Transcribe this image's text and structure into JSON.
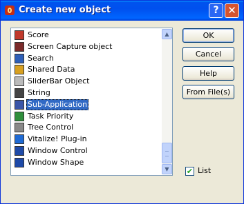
{
  "window": {
    "title": "Create new object",
    "help_glyph": "?",
    "close_glyph": "✕"
  },
  "list": {
    "items": [
      {
        "label": "Score",
        "icon": "score-icon",
        "color": "#c0392b"
      },
      {
        "label": "Screen Capture object",
        "icon": "camera-icon",
        "color": "#7a2a2a"
      },
      {
        "label": "Search",
        "icon": "search-icon",
        "color": "#2e5fb8"
      },
      {
        "label": "Shared Data",
        "icon": "shared-data-icon",
        "color": "#d8a020"
      },
      {
        "label": "SliderBar Object",
        "icon": "slider-icon",
        "color": "#bbbbbb"
      },
      {
        "label": "String",
        "icon": "string-icon",
        "color": "#444444"
      },
      {
        "label": "Sub-Application",
        "icon": "sub-application-icon",
        "color": "#3a56a8",
        "selected": true
      },
      {
        "label": "Task Priority",
        "icon": "task-priority-icon",
        "color": "#2f8f3c"
      },
      {
        "label": "Tree Control",
        "icon": "tree-control-icon",
        "color": "#888888"
      },
      {
        "label": "Vitalize! Plug-in",
        "icon": "plugin-icon",
        "color": "#1e6ad4"
      },
      {
        "label": "Window Control",
        "icon": "window-control-icon",
        "color": "#1e4aa8"
      },
      {
        "label": "Window Shape",
        "icon": "window-shape-icon",
        "color": "#1e4aa8"
      }
    ]
  },
  "buttons": {
    "ok": "OK",
    "cancel": "Cancel",
    "help": "Help",
    "from_files": "From File(s)"
  },
  "checkbox": {
    "label": "List",
    "checked": true,
    "mark": "✔"
  },
  "scroll": {
    "up": "▲",
    "down": "▼"
  }
}
